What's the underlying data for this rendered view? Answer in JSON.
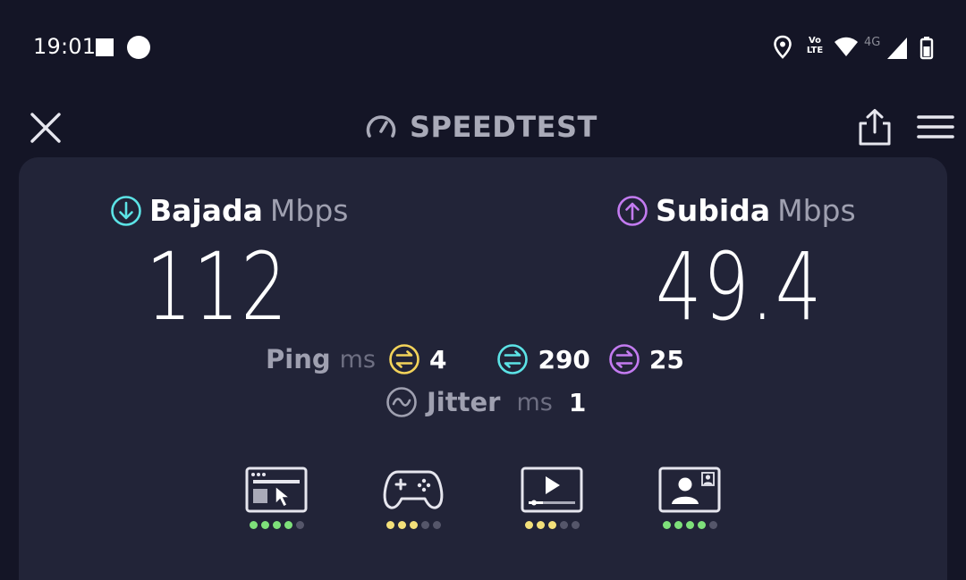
{
  "status_bar": {
    "time": "19:01",
    "network_type": "4G",
    "volte_label_top": "Vo",
    "volte_label_bottom": "LTE"
  },
  "header": {
    "title": "SPEEDTEST"
  },
  "download": {
    "label": "Bajada",
    "unit": "Mbps",
    "value": "112",
    "color": "#5ce3e6"
  },
  "upload": {
    "label": "Subida",
    "unit": "Mbps",
    "value": "49.4",
    "color": "#c37bf0"
  },
  "ping": {
    "label": "Ping",
    "unit": "ms",
    "idle": "4",
    "download": "290",
    "upload": "25",
    "idle_color": "#f3d35a",
    "download_color": "#5ce3e6",
    "upload_color": "#c37bf0"
  },
  "jitter": {
    "label": "Jitter",
    "unit": "ms",
    "value": "1"
  },
  "performance": [
    {
      "icon": "web-browsing-icon",
      "rating": 4,
      "max": 5,
      "color": "#7ee07a"
    },
    {
      "icon": "gaming-icon",
      "rating": 3,
      "max": 5,
      "color": "#f3e07a"
    },
    {
      "icon": "video-streaming-icon",
      "rating": 3,
      "max": 5,
      "color": "#f3e07a"
    },
    {
      "icon": "video-call-icon",
      "rating": 4,
      "max": 5,
      "color": "#7ee07a"
    }
  ]
}
